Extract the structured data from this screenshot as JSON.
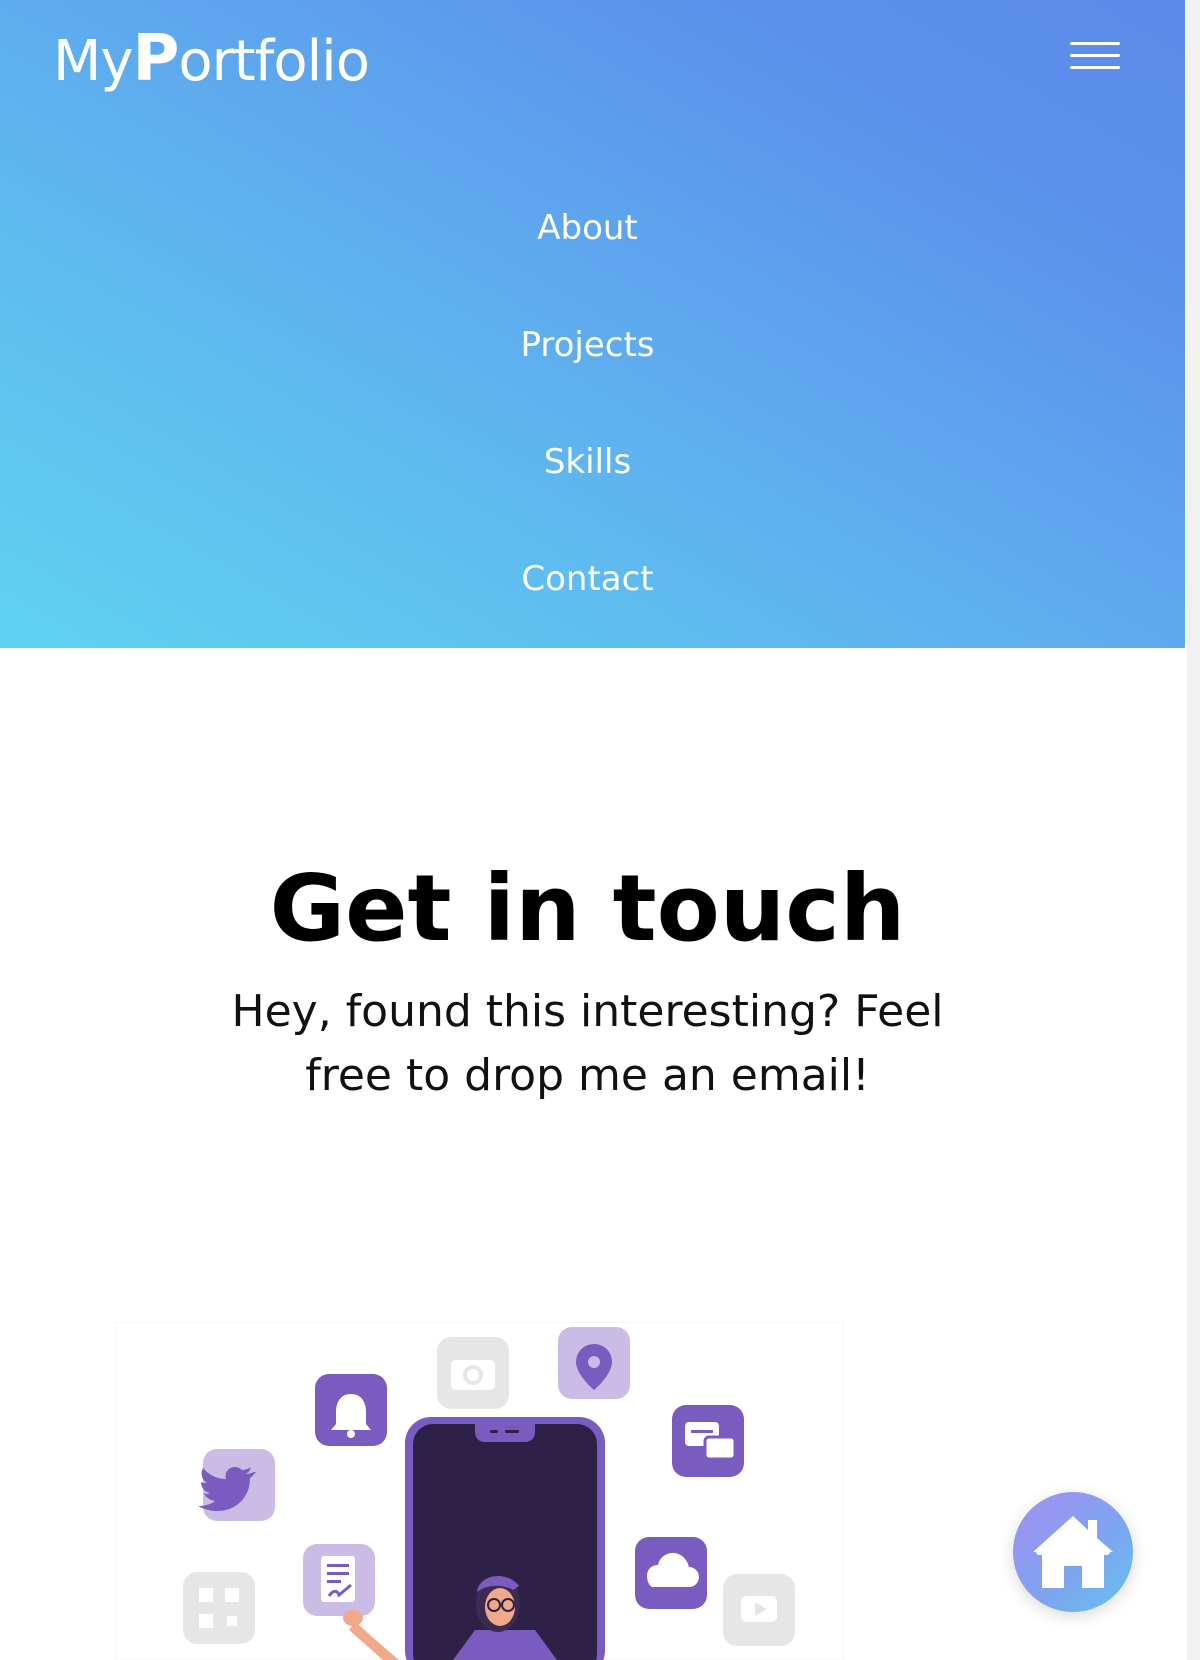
{
  "header": {
    "logo_prefix": "My",
    "logo_initial": "P",
    "logo_suffix": "ortfolio",
    "menu_icon": "hamburger-menu-icon",
    "gradient_start": "#5fd3f1",
    "gradient_end": "#5b8aea"
  },
  "nav": {
    "items": [
      {
        "label": "About"
      },
      {
        "label": "Projects"
      },
      {
        "label": "Skills"
      },
      {
        "label": "Contact"
      }
    ]
  },
  "contact": {
    "title": "Get in touch",
    "subtitle": "Hey, found this interesting? Feel free to drop me an email!"
  },
  "illustration": {
    "icons": [
      "bell-icon",
      "camera-icon",
      "location-pin-icon",
      "chat-icon",
      "twitter-icon",
      "document-icon",
      "cloud-icon",
      "qr-code-icon",
      "youtube-icon",
      "smartphone-icon",
      "person-figure"
    ],
    "accent": "#7a5bc0",
    "accent_light": "#cbbce6"
  },
  "home_button": {
    "icon": "home-icon"
  }
}
